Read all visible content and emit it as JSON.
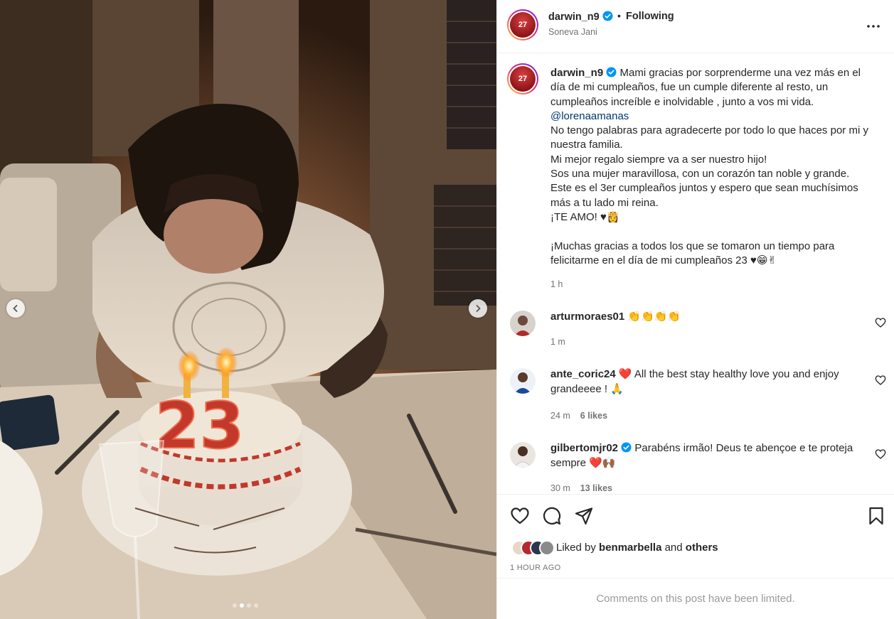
{
  "post": {
    "username": "darwin_n9",
    "separator": "•",
    "follow_status": "Following",
    "location": "Soneva Jani",
    "avatar_text": "27"
  },
  "caption": {
    "username": "darwin_n9",
    "line1": " Mami gracias por sorprenderme una vez más en el día de mi cumpleaños, fue un cumple diferente al resto, un cumpleaños increíble e inolvidable , junto a vos mi vida.",
    "mention": "@lorenaamanas",
    "body": "No tengo palabras para agradecerte por todo lo que haces por mi y nuestra familia.\nMi mejor regalo siempre va a ser nuestro hijo!\nSos una mujer maravillosa, con un corazón tan noble y grande.\nEste es el 3er cumpleaños juntos y espero que sean muchísimos más a tu lado mi reina.\n¡TE AMO! ♥👸\n\n¡Muchas gracias a todos los que se tomaron un tiempo para felicitarme en el día de mi cumpleaños 23 ♥😁✌",
    "time": "1 h"
  },
  "comments": [
    {
      "username": "arturmoraes01",
      "text": " 👏👏👏👏",
      "time": "1 m",
      "likes": ""
    },
    {
      "username": "ante_coric24",
      "text": " ❤️ All the best stay healthy love you and enjoy grandeeee ! 🙏",
      "time": "24 m",
      "likes": "6 likes"
    },
    {
      "username": "gilbertomjr02",
      "text": " Parabéns irmão! Deus te abençoe e te proteja sempre ❤️🙌🏾",
      "time": "30 m",
      "likes": "13 likes"
    }
  ],
  "likes": {
    "prefix": "Liked by ",
    "user": "benmarbella",
    "middle": " and ",
    "others": "others",
    "time_ago": "1 HOUR AGO"
  },
  "footer": {
    "limited_text": "Comments on this post have been limited."
  },
  "colors": {
    "verified": "#0095f6",
    "mention": "#00376b",
    "secondary_text": "#737373"
  },
  "carousel": {
    "current": 2,
    "total": 4
  }
}
